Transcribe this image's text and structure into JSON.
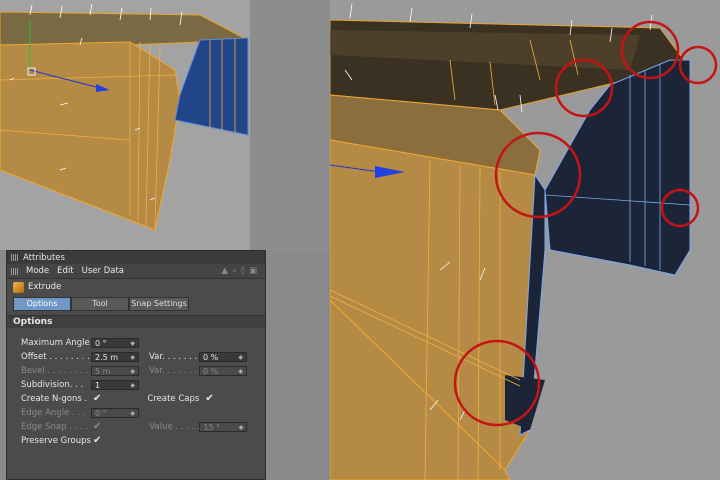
{
  "panel": {
    "title": "Attributes",
    "menu": [
      "Mode",
      "Edit",
      "User Data"
    ],
    "object_name": "Extrude",
    "tabs": [
      "Options",
      "Tool",
      "Snap Settings"
    ],
    "active_tab": "Options",
    "section_title": "Options",
    "fields": {
      "max_angle": {
        "label": "Maximum Angle",
        "value": "0 °"
      },
      "offset": {
        "label": "Offset . . . . . . . .",
        "value": "2.5 m"
      },
      "offset_var": {
        "label": "Var. . . . . . .",
        "value": "0 %"
      },
      "bevel": {
        "label": "Bevel . . . . . . . .",
        "value": "5 m"
      },
      "bevel_var": {
        "label": "Var. . . . . . .",
        "value": "0 %"
      },
      "subdivision": {
        "label": "Subdivision. . .",
        "value": "1"
      },
      "create_ngons": {
        "label": "Create N-gons .",
        "checked": "✔"
      },
      "create_caps": {
        "label": "Create Caps",
        "checked": "✔"
      },
      "edge_angle": {
        "label": "Edge Angle . . .",
        "value": "0 °"
      },
      "edge_snap": {
        "label": "Edge Snap . . . .",
        "checked": "✔"
      },
      "value": {
        "label": "Value . . . . .",
        "value": "15 °"
      },
      "preserve_groups": {
        "label": "Preserve Groups",
        "checked": "✔"
      }
    }
  },
  "colors": {
    "mesh_face": "#b08a4a",
    "mesh_edge": "#f0a830",
    "blue_face": "#1f3e7a",
    "dark_face": "#232c3d",
    "highlight_circle": "#c41414",
    "accent_tab": "#6f97c8"
  },
  "icons": [
    "panel-grip-icon",
    "extrude-object-icon",
    "move-axis-arrow-icon",
    "null-object-icon"
  ]
}
